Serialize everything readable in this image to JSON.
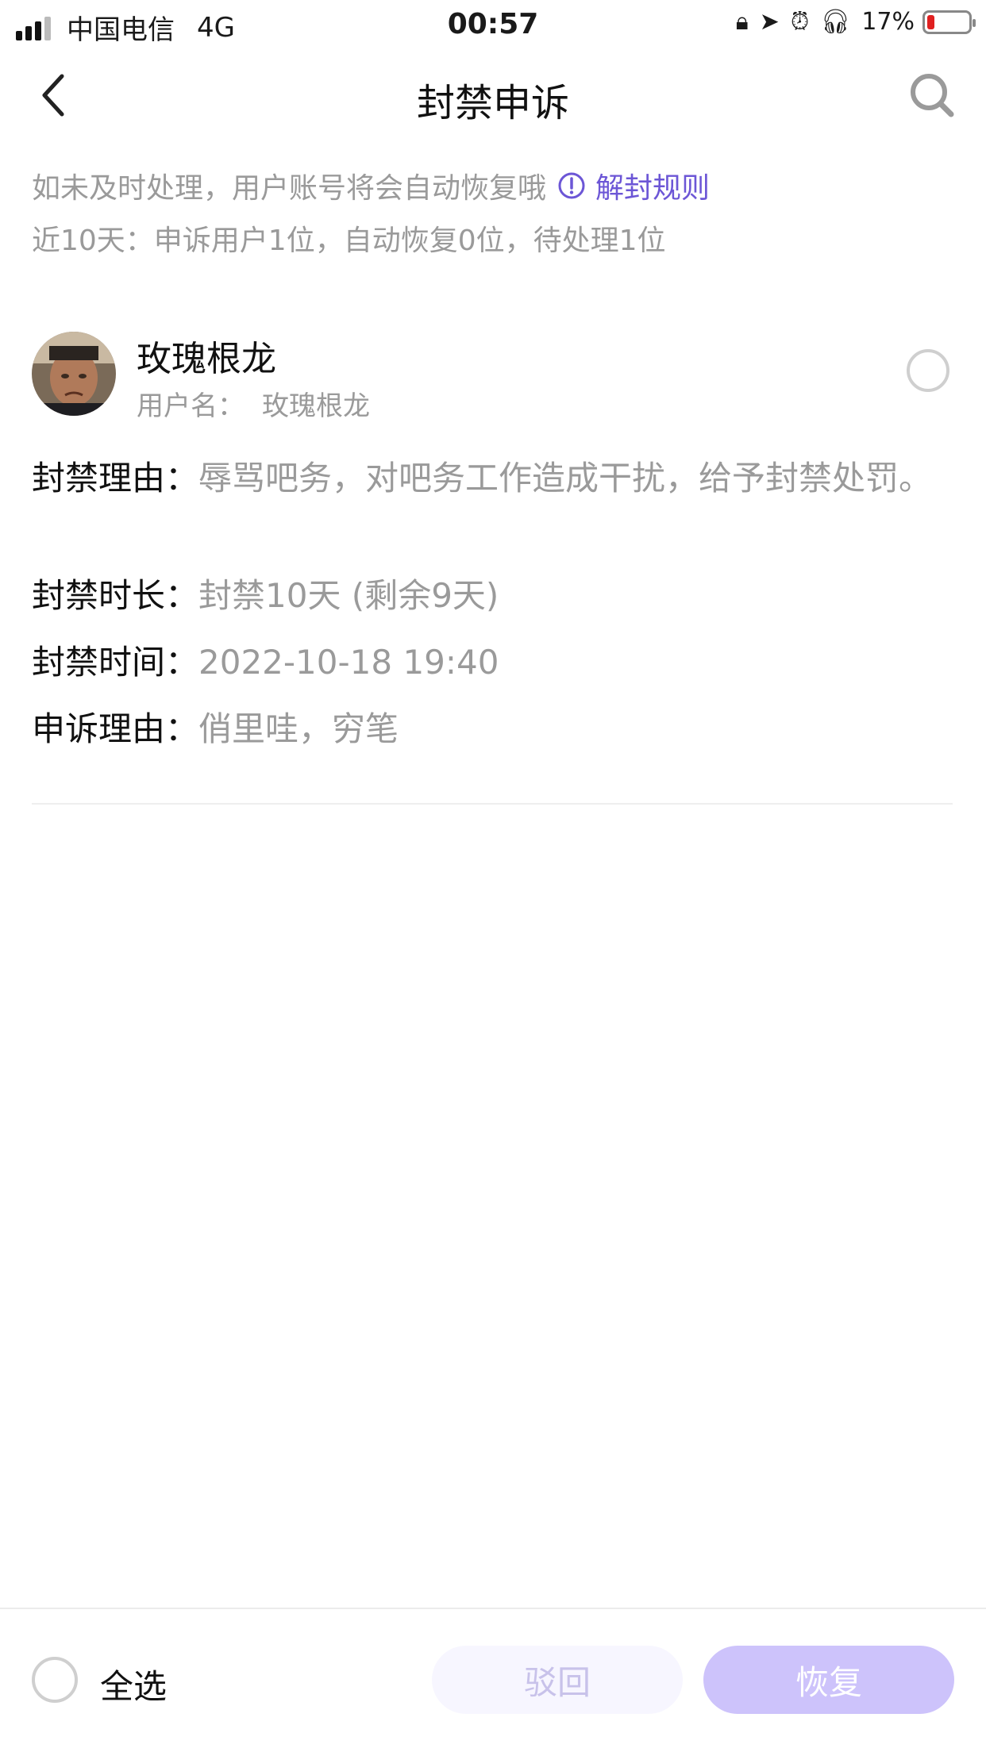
{
  "status_bar": {
    "carrier": "中国电信",
    "network": "4G",
    "time": "00:57",
    "battery_percent": "17%",
    "battery_level": 0.17
  },
  "nav": {
    "title": "封禁申诉"
  },
  "notice": {
    "text": "如未及时处理，用户账号将会自动恢复哦",
    "rules_link": "解封规则",
    "stats": "近10天：申诉用户1位，自动恢复0位，待处理1位"
  },
  "user": {
    "name": "玫瑰根龙",
    "username_label": "用户名：",
    "username": "玫瑰根龙",
    "ban_reason_label": "封禁理由：",
    "ban_reason": "辱骂吧务，对吧务工作造成干扰，给予封禁处罚。",
    "ban_duration_label": "封禁时长：",
    "ban_duration": "封禁10天 (剩余9天)",
    "ban_time_label": "封禁时间：",
    "ban_time": "2022-10-18 19:40",
    "appeal_reason_label": "申诉理由：",
    "appeal_reason": "俏里哇，穷笔"
  },
  "bottom": {
    "select_all": "全选",
    "reject": "驳回",
    "restore": "恢复"
  },
  "colors": {
    "accent": "#6c56d6",
    "muted_text": "#9a9a9a",
    "restore_button": "#cdc3fb",
    "reject_button": "#f7f6ff",
    "battery_low": "#e02020"
  },
  "icons": {
    "back": "chevron-left-icon",
    "search": "search-icon",
    "info": "info-circle-icon"
  }
}
